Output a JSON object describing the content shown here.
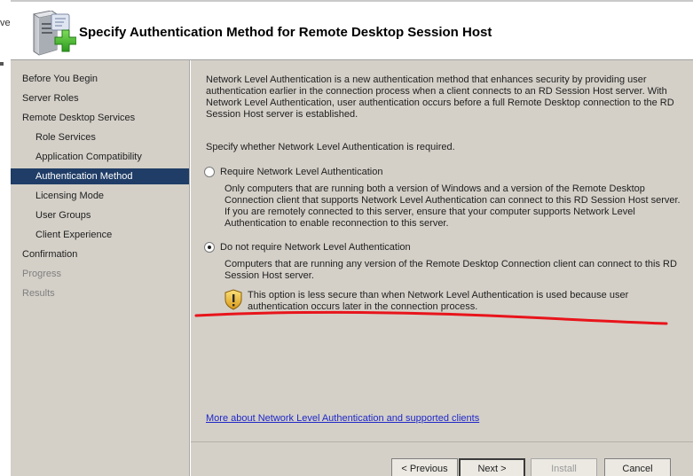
{
  "background_window": {
    "label_fragment": "ve"
  },
  "header": {
    "title": "Specify Authentication Method for Remote Desktop Session Host"
  },
  "nav": {
    "items": [
      {
        "label": "Before You Begin",
        "state": "normal"
      },
      {
        "label": "Server Roles",
        "state": "normal"
      },
      {
        "label": "Remote Desktop Services",
        "state": "normal"
      },
      {
        "label": "Role Services",
        "state": "normal"
      },
      {
        "label": "Application Compatibility",
        "state": "normal"
      },
      {
        "label": "Authentication Method",
        "state": "active"
      },
      {
        "label": "Licensing Mode",
        "state": "normal"
      },
      {
        "label": "User Groups",
        "state": "normal"
      },
      {
        "label": "Client Experience",
        "state": "normal"
      },
      {
        "label": "Confirmation",
        "state": "normal"
      },
      {
        "label": "Progress",
        "state": "disabled"
      },
      {
        "label": "Results",
        "state": "disabled"
      }
    ]
  },
  "content": {
    "intro": [
      "Network Level Authentication is a new authentication method that enhances security by providing user",
      "authentication earlier in the connection process when a client connects to an RD Session Host server. With",
      "Network Level Authentication, user authentication occurs before a full Remote Desktop connection to the RD",
      "Session Host server is established."
    ],
    "prompt": "Specify whether Network Level Authentication is required.",
    "options": [
      {
        "label": "Require Network Level Authentication",
        "selected": false,
        "description": [
          "Only computers that are running both a version of Windows and a version of the Remote Desktop",
          "Connection client that supports Network Level Authentication can connect to this RD Session Host server.",
          "If you are remotely connected to this server, ensure that your computer supports Network Level",
          "Authentication to enable reconnection to this server."
        ]
      },
      {
        "label": "Do not require Network Level Authentication",
        "selected": true,
        "description": [
          "Computers that are running any version of the Remote Desktop Connection client can connect to this RD",
          "Session Host server."
        ]
      }
    ],
    "warning": [
      "This option is less secure than when Network Level Authentication is used because user",
      "authentication occurs later in the connection process."
    ],
    "annotation_color": "#e8141b",
    "link": "More about Network Level Authentication and supported clients"
  },
  "buttons": {
    "previous": "< Previous",
    "next": "Next >",
    "install": "Install",
    "cancel": "Cancel"
  },
  "colors": {
    "panel": "#d4d0c8",
    "nav_active": "#1f3d66",
    "link": "#1f27c8",
    "disabled_text": "#7f7f7f"
  }
}
